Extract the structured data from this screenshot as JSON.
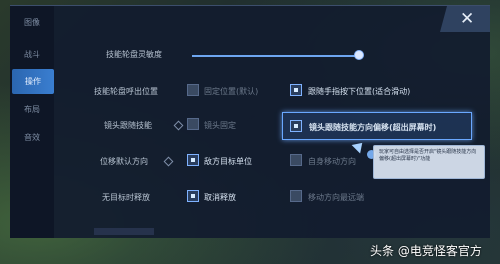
{
  "sidebar": {
    "items": [
      {
        "label": "图像"
      },
      {
        "label": "战斗"
      },
      {
        "label": "操作"
      },
      {
        "label": "布局"
      },
      {
        "label": "音效"
      }
    ]
  },
  "close_label": "✕",
  "settings": {
    "sensitivity": {
      "label": "技能轮盘灵敏度",
      "value_fraction": 0.98
    },
    "wheel_position": {
      "label": "技能轮盘呼出位置",
      "options": [
        "固定位置(默认)",
        "跟随手指按下位置(适合滑动)"
      ]
    },
    "camera_follow": {
      "label": "镜头跟随技能",
      "options": [
        "镜头固定",
        "镜头跟随技能方向偏移(超出屏幕时)"
      ]
    },
    "displacement": {
      "label": "位移默认方向",
      "options": [
        "敌方目标单位",
        "自身移动方向"
      ]
    },
    "no_target": {
      "label": "无目标时释放",
      "options": [
        "取消释放",
        "移动方向最远端"
      ]
    }
  },
  "tooltip_text": "玩家可自由选择是否开启\"镜头跟随技能方向偏移(超出屏幕时)\"功能",
  "watermark": "头条 @电竞怪客官方"
}
